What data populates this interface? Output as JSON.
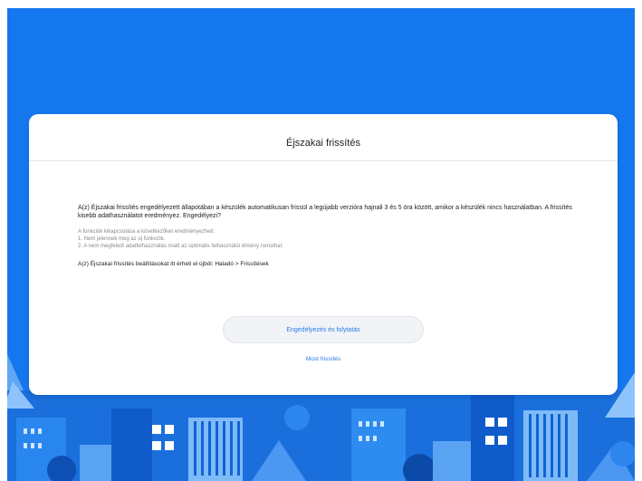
{
  "dialog": {
    "title": "Éjszakai frissítés",
    "message": "A(z) Éjszakai frissítés engedélyezett állapotában a készülék automatikusan frissül a legújabb verzióra hajnali 3 és 5 óra között, amikor a készülék nincs használatban. A frissítés kisebb adathasználatot eredményez. Engedélyezi?",
    "notes_heading": "A funkciók kikapcsolása a következőket eredményezheti:",
    "notes": [
      "1. Nem jelennek meg az új funkciók.",
      "2. A nem megfelelő adatfelhasználás miatt az optimális felhasználói élmény romolhat."
    ],
    "footer": "A(z) Éjszakai frissítés beállításokat itt érheti el újból: Haladó > Frissítések",
    "primary_button": "Engedélyezés és folytatás",
    "secondary_link": "Most frissítés"
  },
  "colors": {
    "background": "#1577ee",
    "accent": "#2b7be8"
  }
}
